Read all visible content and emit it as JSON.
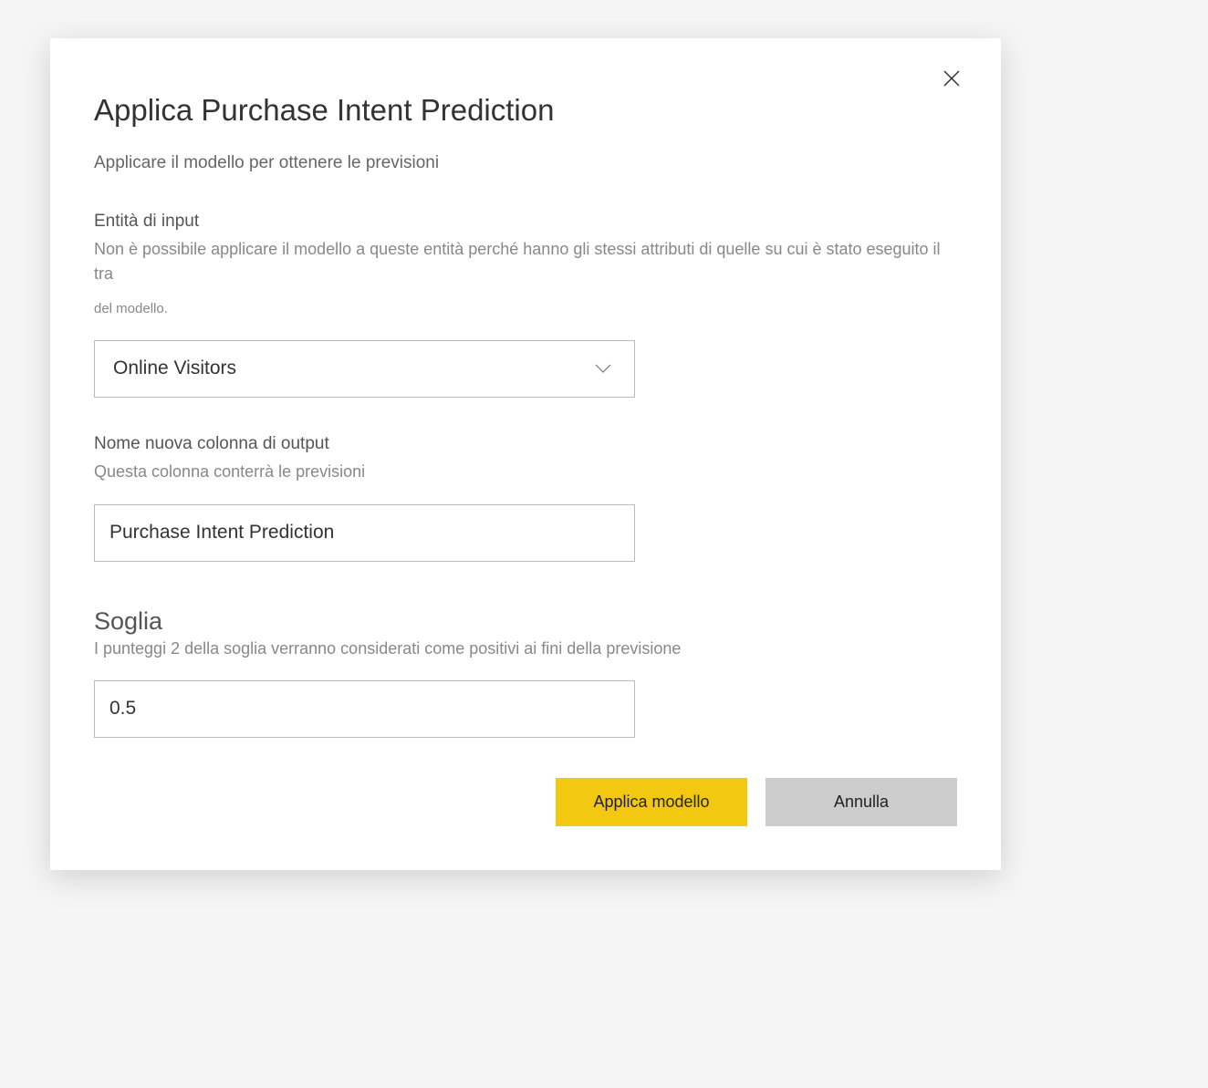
{
  "dialog": {
    "title": "Applica Purchase Intent Prediction",
    "subtitle": "Applicare il modello per ottenere le previsioni"
  },
  "input_entity": {
    "label": "Entità di input",
    "description_line1": "Non è possibile applicare il modello a queste entità perché hanno gli stessi attributi di quelle su cui è stato eseguito il tra",
    "description_line2": "del modello.",
    "value": "Online Visitors"
  },
  "output_column": {
    "label": "Nome nuova colonna di output",
    "description": "Questa colonna conterrà le previsioni",
    "value": "Purchase Intent Prediction"
  },
  "threshold": {
    "heading": "Soglia",
    "description": "I punteggi 2 della soglia verranno considerati come positivi ai fini della previsione",
    "value": "0.5"
  },
  "buttons": {
    "apply": "Applica modello",
    "cancel": "Annulla"
  }
}
